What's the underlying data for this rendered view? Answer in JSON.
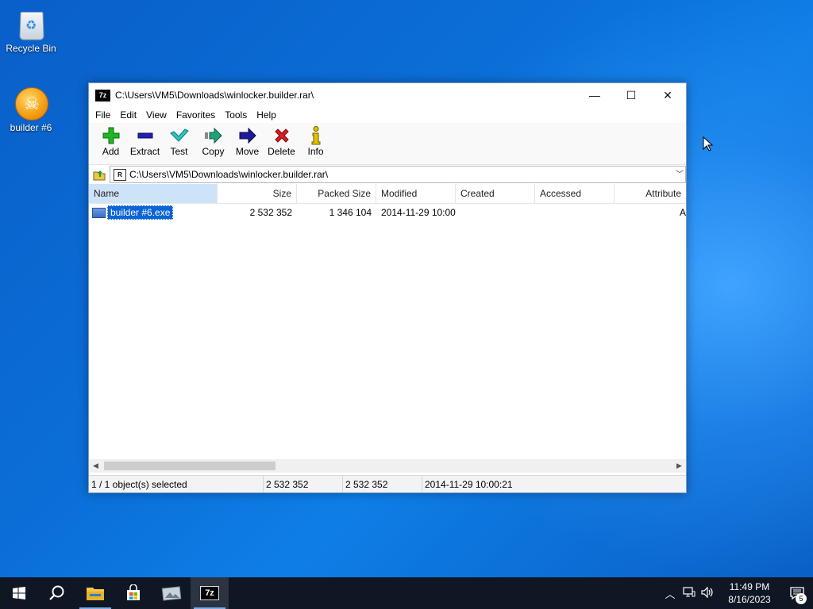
{
  "desktop": {
    "icons": [
      {
        "label": "Recycle Bin",
        "icon": "recycle-bin-icon"
      },
      {
        "label": "builder #6",
        "icon": "skull-icon"
      }
    ]
  },
  "window": {
    "app_icon_text": "7z",
    "title": "C:\\Users\\VM5\\Downloads\\winlocker.builder.rar\\",
    "controls": {
      "minimize": "—",
      "maximize": "☐",
      "close": "✕"
    },
    "menu": [
      "File",
      "Edit",
      "View",
      "Favorites",
      "Tools",
      "Help"
    ],
    "toolbar": [
      {
        "label": "Add",
        "icon": "plus-icon",
        "color": "#1fa11f"
      },
      {
        "label": "Extract",
        "icon": "minus-icon",
        "color": "#1c1ca0"
      },
      {
        "label": "Test",
        "icon": "check-icon",
        "color": "#1aa7a7"
      },
      {
        "label": "Copy",
        "icon": "copy-arrow-icon",
        "color": "#1f8a6a"
      },
      {
        "label": "Move",
        "icon": "move-arrow-icon",
        "color": "#1c1c8a"
      },
      {
        "label": "Delete",
        "icon": "x-icon",
        "color": "#d4141c"
      },
      {
        "label": "Info",
        "icon": "info-icon",
        "color": "#b8a000"
      }
    ],
    "address": {
      "icon_text": "R",
      "path": "C:\\Users\\VM5\\Downloads\\winlocker.builder.rar\\"
    },
    "columns": [
      "Name",
      "Size",
      "Packed Size",
      "Modified",
      "Created",
      "Accessed",
      "Attribute"
    ],
    "rows": [
      {
        "name": "builder #6.exe",
        "size": "2 532 352",
        "packed": "1 346 104",
        "modified": "2014-11-29 10:00",
        "created": "",
        "accessed": "",
        "attr": "A"
      }
    ],
    "status": {
      "selection": "1 / 1 object(s) selected",
      "size": "2 532 352",
      "packed": "2 532 352",
      "modified": "2014-11-29 10:00:21"
    }
  },
  "taskbar": {
    "time": "11:49 PM",
    "date": "8/16/2023",
    "notifications": "5",
    "apps": [
      "start-icon",
      "search-icon",
      "file-explorer-icon",
      "store-icon",
      "photos-icon",
      "7zip-icon"
    ],
    "active_app_label": "7z"
  }
}
